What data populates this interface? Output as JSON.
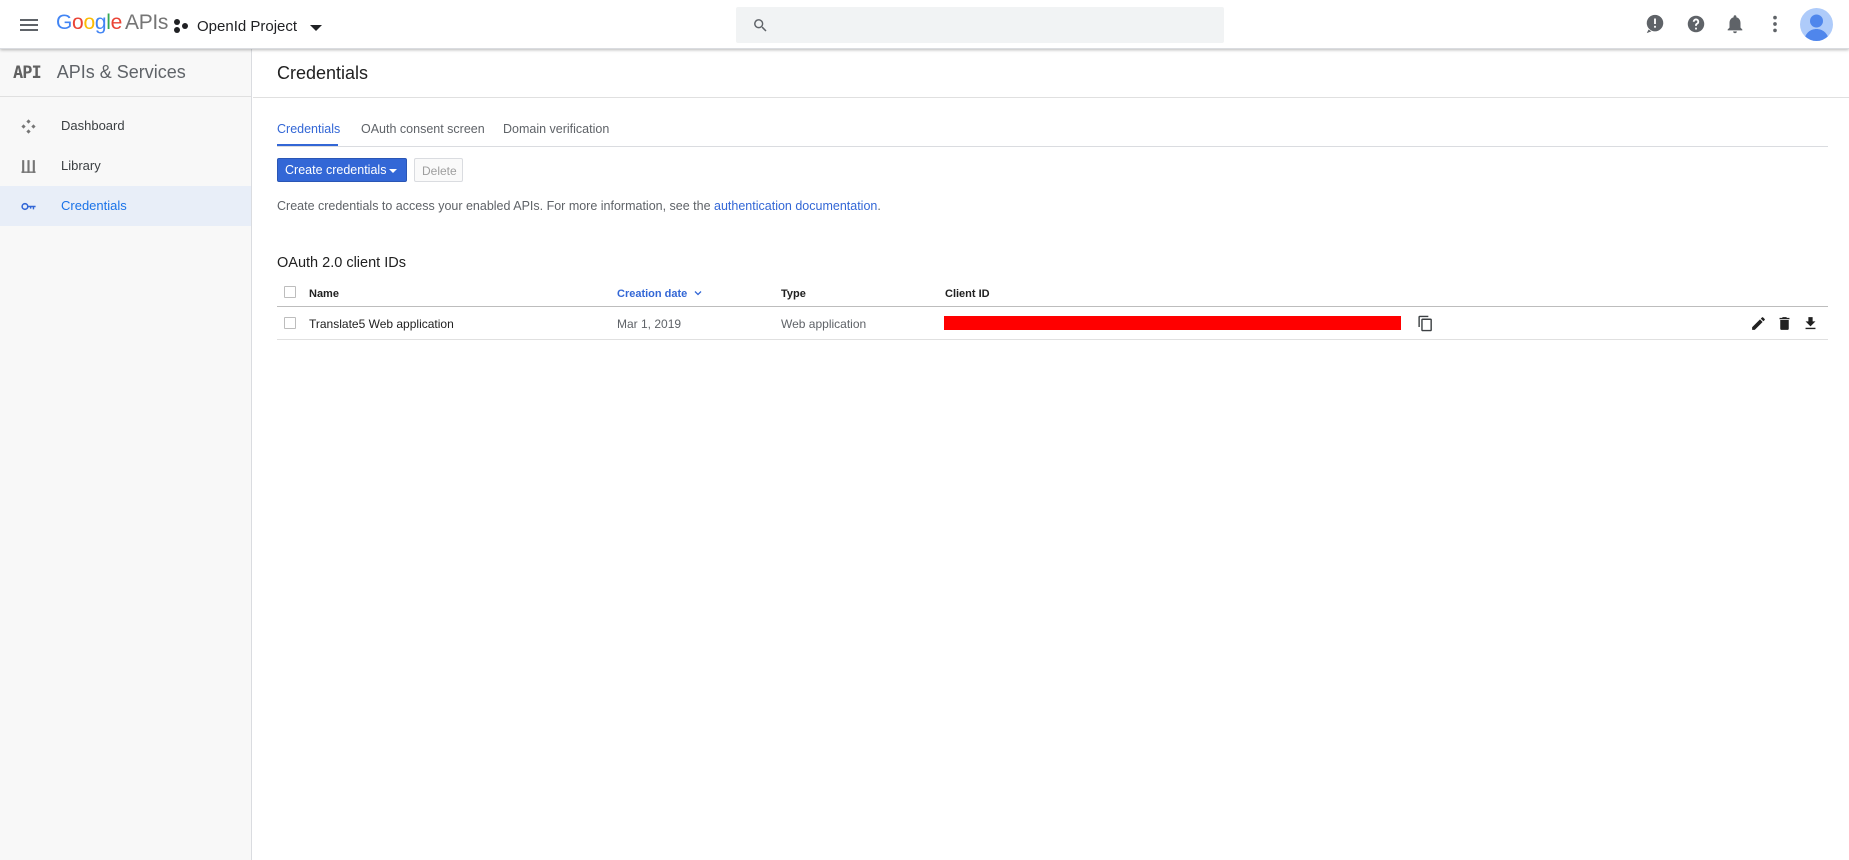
{
  "header": {
    "logo_google": "Google",
    "logo_apis": "APIs",
    "project_name": "OpenId Project",
    "search_placeholder": "",
    "icons": [
      "menu-icon",
      "search-icon",
      "feedback-icon",
      "help-icon",
      "notifications-icon",
      "more-vert-icon",
      "account-avatar"
    ]
  },
  "sidebar": {
    "mark": "API",
    "title": "APIs & Services",
    "items": [
      {
        "label": "Dashboard",
        "icon": "dashboard-icon",
        "active": false
      },
      {
        "label": "Library",
        "icon": "library-icon",
        "active": false
      },
      {
        "label": "Credentials",
        "icon": "key-icon",
        "active": true
      }
    ]
  },
  "main": {
    "title": "Credentials",
    "tabs": [
      {
        "label": "Credentials",
        "active": true
      },
      {
        "label": "OAuth consent screen",
        "active": false
      },
      {
        "label": "Domain verification",
        "active": false
      }
    ],
    "create_button": "Create credentials",
    "delete_button": "Delete",
    "info_text": "Create credentials to access your enabled APIs. For more information, see the ",
    "info_link": "authentication documentation",
    "info_suffix": ".",
    "section_title": "OAuth 2.0 client IDs",
    "table": {
      "columns": [
        "Name",
        "Creation date",
        "Type",
        "Client ID"
      ],
      "sorted_column": "Creation date",
      "rows": [
        {
          "name": "Translate5 Web application",
          "creation_date": "Mar 1, 2019",
          "type": "Web application",
          "client_id": ""
        }
      ]
    }
  },
  "colors": {
    "accent": "#3367d6",
    "sidebar_bg": "#f8f8f8",
    "active_item_bg": "#e8eef8",
    "redaction": "#ff0000"
  }
}
